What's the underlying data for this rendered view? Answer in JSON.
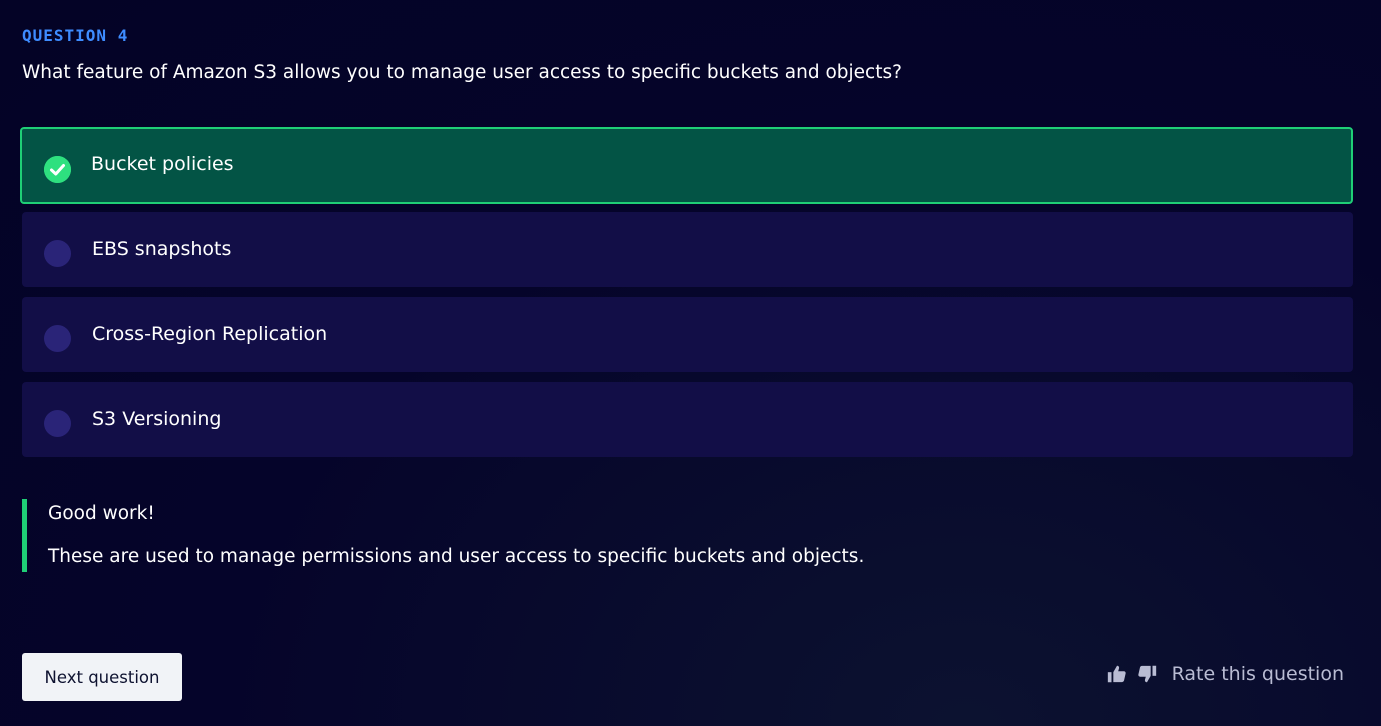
{
  "question": {
    "number_label": "QUESTION 4",
    "text": "What feature of Amazon S3 allows you to manage user access to specific buckets and objects?"
  },
  "options": [
    {
      "label": "Bucket policies",
      "state": "correct"
    },
    {
      "label": "EBS snapshots",
      "state": "unselected"
    },
    {
      "label": "Cross-Region Replication",
      "state": "unselected"
    },
    {
      "label": "S3 Versioning",
      "state": "unselected"
    }
  ],
  "feedback": {
    "title": "Good work!",
    "body": "These are used to manage permissions and user access to specific buckets and objects."
  },
  "footer": {
    "next_label": "Next question",
    "rate_label": "Rate this question",
    "thumbs_up_icon": "thumbs-up-icon",
    "thumbs_down_icon": "thumbs-down-icon"
  },
  "colors": {
    "background": "#05042a",
    "accent_blue": "#3e8cff",
    "correct_green": "#1fcf76",
    "correct_bg": "#035445",
    "option_bg": "#120e47"
  }
}
